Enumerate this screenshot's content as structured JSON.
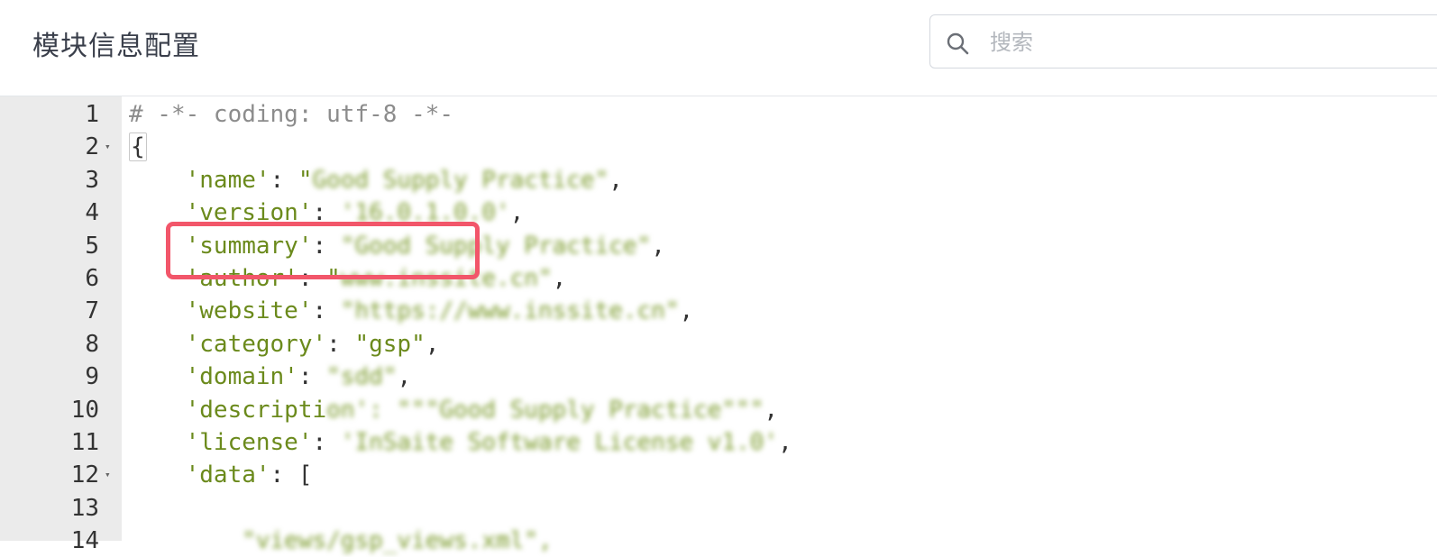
{
  "header": {
    "title": "模块信息配置",
    "search": {
      "placeholder": "搜索",
      "value": ""
    }
  },
  "editor": {
    "lines": [
      {
        "num": "1",
        "fold": "",
        "tokens": [
          {
            "t": "# -*- coding: utf-8 -*-",
            "c": "comment"
          }
        ]
      },
      {
        "num": "2",
        "fold": "▾",
        "tokens": [
          {
            "t": "{",
            "c": "brace"
          }
        ]
      },
      {
        "num": "3",
        "fold": "",
        "tokens": [
          {
            "t": "    'name'",
            "c": "str"
          },
          {
            "t": ": ",
            "c": "punct"
          },
          {
            "t": "\"",
            "c": "str"
          },
          {
            "t": "Good Supply Practice\"",
            "c": "blur"
          },
          {
            "t": ",",
            "c": "punct"
          }
        ]
      },
      {
        "num": "4",
        "fold": "",
        "tokens": [
          {
            "t": "    'version'",
            "c": "str"
          },
          {
            "t": ": ",
            "c": "punct"
          },
          {
            "t": "'16.0.1.0.0'",
            "c": "blur"
          },
          {
            "t": ",",
            "c": "punct"
          }
        ]
      },
      {
        "num": "5",
        "fold": "",
        "tokens": [
          {
            "t": "    'summary'",
            "c": "str"
          },
          {
            "t": ": ",
            "c": "punct"
          },
          {
            "t": "\"Good Supply Practice\"",
            "c": "blur"
          },
          {
            "t": ",",
            "c": "punct"
          }
        ]
      },
      {
        "num": "6",
        "fold": "",
        "tokens": [
          {
            "t": "    'author'",
            "c": "str"
          },
          {
            "t": ": ",
            "c": "punct"
          },
          {
            "t": "\"",
            "c": "str"
          },
          {
            "t": "www.inssite.cn\"",
            "c": "blur"
          },
          {
            "t": ",",
            "c": "punct"
          }
        ]
      },
      {
        "num": "7",
        "fold": "",
        "tokens": [
          {
            "t": "    'website'",
            "c": "str"
          },
          {
            "t": ": ",
            "c": "punct"
          },
          {
            "t": "\"https://www.inssite.cn\"",
            "c": "blur"
          },
          {
            "t": ",",
            "c": "punct"
          }
        ]
      },
      {
        "num": "8",
        "fold": "",
        "tokens": [
          {
            "t": "    'category'",
            "c": "str"
          },
          {
            "t": ": ",
            "c": "punct"
          },
          {
            "t": "\"gsp\"",
            "c": "str"
          },
          {
            "t": ",",
            "c": "punct"
          }
        ]
      },
      {
        "num": "9",
        "fold": "",
        "tokens": [
          {
            "t": "    'domain'",
            "c": "str"
          },
          {
            "t": ": ",
            "c": "punct"
          },
          {
            "t": "\"sdd\"",
            "c": "blur"
          },
          {
            "t": ",",
            "c": "punct"
          }
        ]
      },
      {
        "num": "10",
        "fold": "",
        "tokens": [
          {
            "t": "    'descripti",
            "c": "str"
          },
          {
            "t": "on': \"\"\"Good Supply Practice\"\"\"",
            "c": "blur"
          },
          {
            "t": ",",
            "c": "punct"
          }
        ]
      },
      {
        "num": "11",
        "fold": "",
        "tokens": [
          {
            "t": "    'license'",
            "c": "str"
          },
          {
            "t": ": ",
            "c": "punct"
          },
          {
            "t": "'InSaite Software License v1.0'",
            "c": "blur"
          },
          {
            "t": ",",
            "c": "punct"
          }
        ]
      },
      {
        "num": "12",
        "fold": "▾",
        "tokens": [
          {
            "t": "    'data'",
            "c": "str"
          },
          {
            "t": ": [",
            "c": "punct"
          }
        ]
      },
      {
        "num": "13",
        "fold": "",
        "tokens": []
      },
      {
        "num": "14",
        "fold": "",
        "tokens": [
          {
            "t": "        \"views/gsp_views.xml\",",
            "c": "blur"
          }
        ]
      }
    ]
  },
  "colors": {
    "code_string": "#6b8a1c",
    "comment": "#8c8c8c",
    "gutter_bg": "#ebebeb",
    "highlight_border": "#f2566a"
  }
}
